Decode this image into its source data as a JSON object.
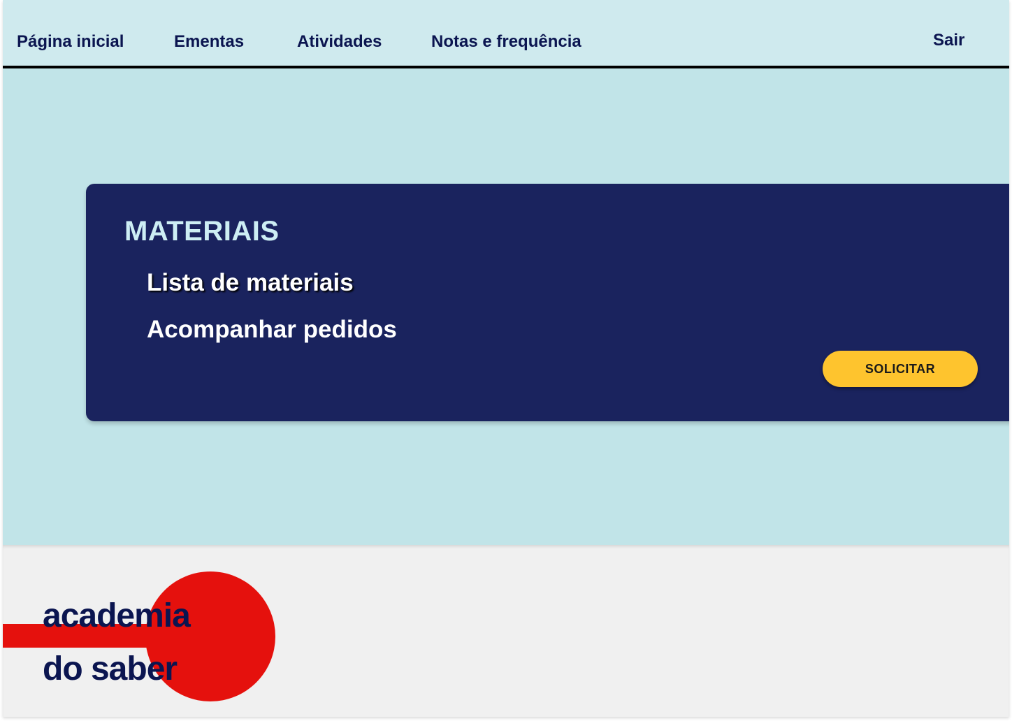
{
  "nav": {
    "items": [
      {
        "label": "Página inicial"
      },
      {
        "label": "Ementas"
      },
      {
        "label": "Atividades"
      },
      {
        "label": "Notas e frequência"
      }
    ],
    "logout_label": "Sair"
  },
  "panel": {
    "title": "MATERIAIS",
    "links": [
      {
        "label": "Lista de materiais"
      },
      {
        "label": "Acompanhar pedidos"
      }
    ],
    "action_label": "SOLICITAR"
  },
  "footer": {
    "logo": {
      "line1": "academia",
      "line2": "do saber"
    }
  },
  "colors": {
    "nav_bg": "#cfeaee",
    "main_bg": "#c1e4e8",
    "panel_bg": "#1a235e",
    "title_color": "#cdeef4",
    "accent_button": "#fec42e",
    "logo_red": "#e5110d",
    "logo_text": "#0b1550",
    "footer_bg": "#f0f0f0"
  }
}
